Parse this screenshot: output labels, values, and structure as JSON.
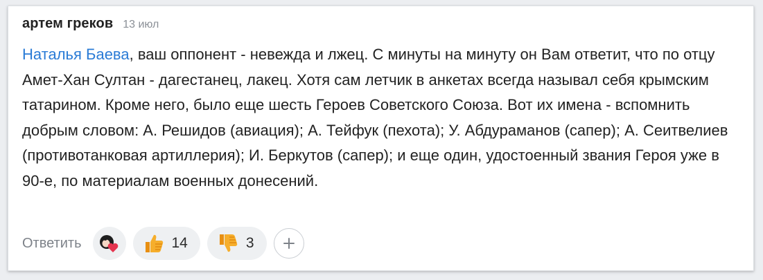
{
  "comment": {
    "author": "артем греков",
    "date": "13 июл",
    "mention": "Наталья Баева",
    "text": ", ваш оппонент - невежда и лжец. С минуты на минуту он Вам ответит, что по отцу Амет-Хан Султан - дагестанец, лакец. Хотя сам летчик в анкетах всегда называл себя крымским татарином. Кроме него, было еще шесть Героев Советского Союза. Вот их имена - вспомнить добрым словом: А. Решидов (авиация); А. Тейфук (пехота); У. Абдураманов (сапер); А. Сеитвелиев (противотанковая артиллерия); И. Беркутов (сапер); и еще один, удостоенный звания Героя уже в 90-е, по материалам военных донесений."
  },
  "actions": {
    "reply_label": "Ответить",
    "reactions_icon": "avatar-heart-icon",
    "like_icon": "thumbs-up-icon",
    "like_count": "14",
    "dislike_icon": "thumbs-down-icon",
    "dislike_count": "3",
    "add_reaction_icon": "plus-icon"
  },
  "colors": {
    "mention": "#2a7bd6",
    "thumb": "#f2a21d",
    "heart": "#e5344f"
  }
}
